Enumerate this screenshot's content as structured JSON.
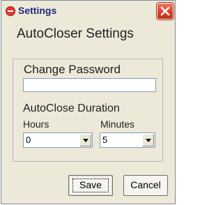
{
  "window": {
    "title": "Settings"
  },
  "heading": "AutoCloser Settings",
  "password": {
    "label": "Change Password",
    "value": ""
  },
  "duration": {
    "label": "AutoClose Duration",
    "hours_label": "Hours",
    "minutes_label": "Minutes",
    "hours_value": "0",
    "minutes_value": "5"
  },
  "buttons": {
    "save": "Save",
    "cancel": "Cancel"
  },
  "icons": {
    "app": "minus-circle-icon",
    "close": "close-icon"
  },
  "colors": {
    "close_button": "#d8432a",
    "title_text": "#1b2b7a",
    "window_bg": "#ece9d8"
  }
}
